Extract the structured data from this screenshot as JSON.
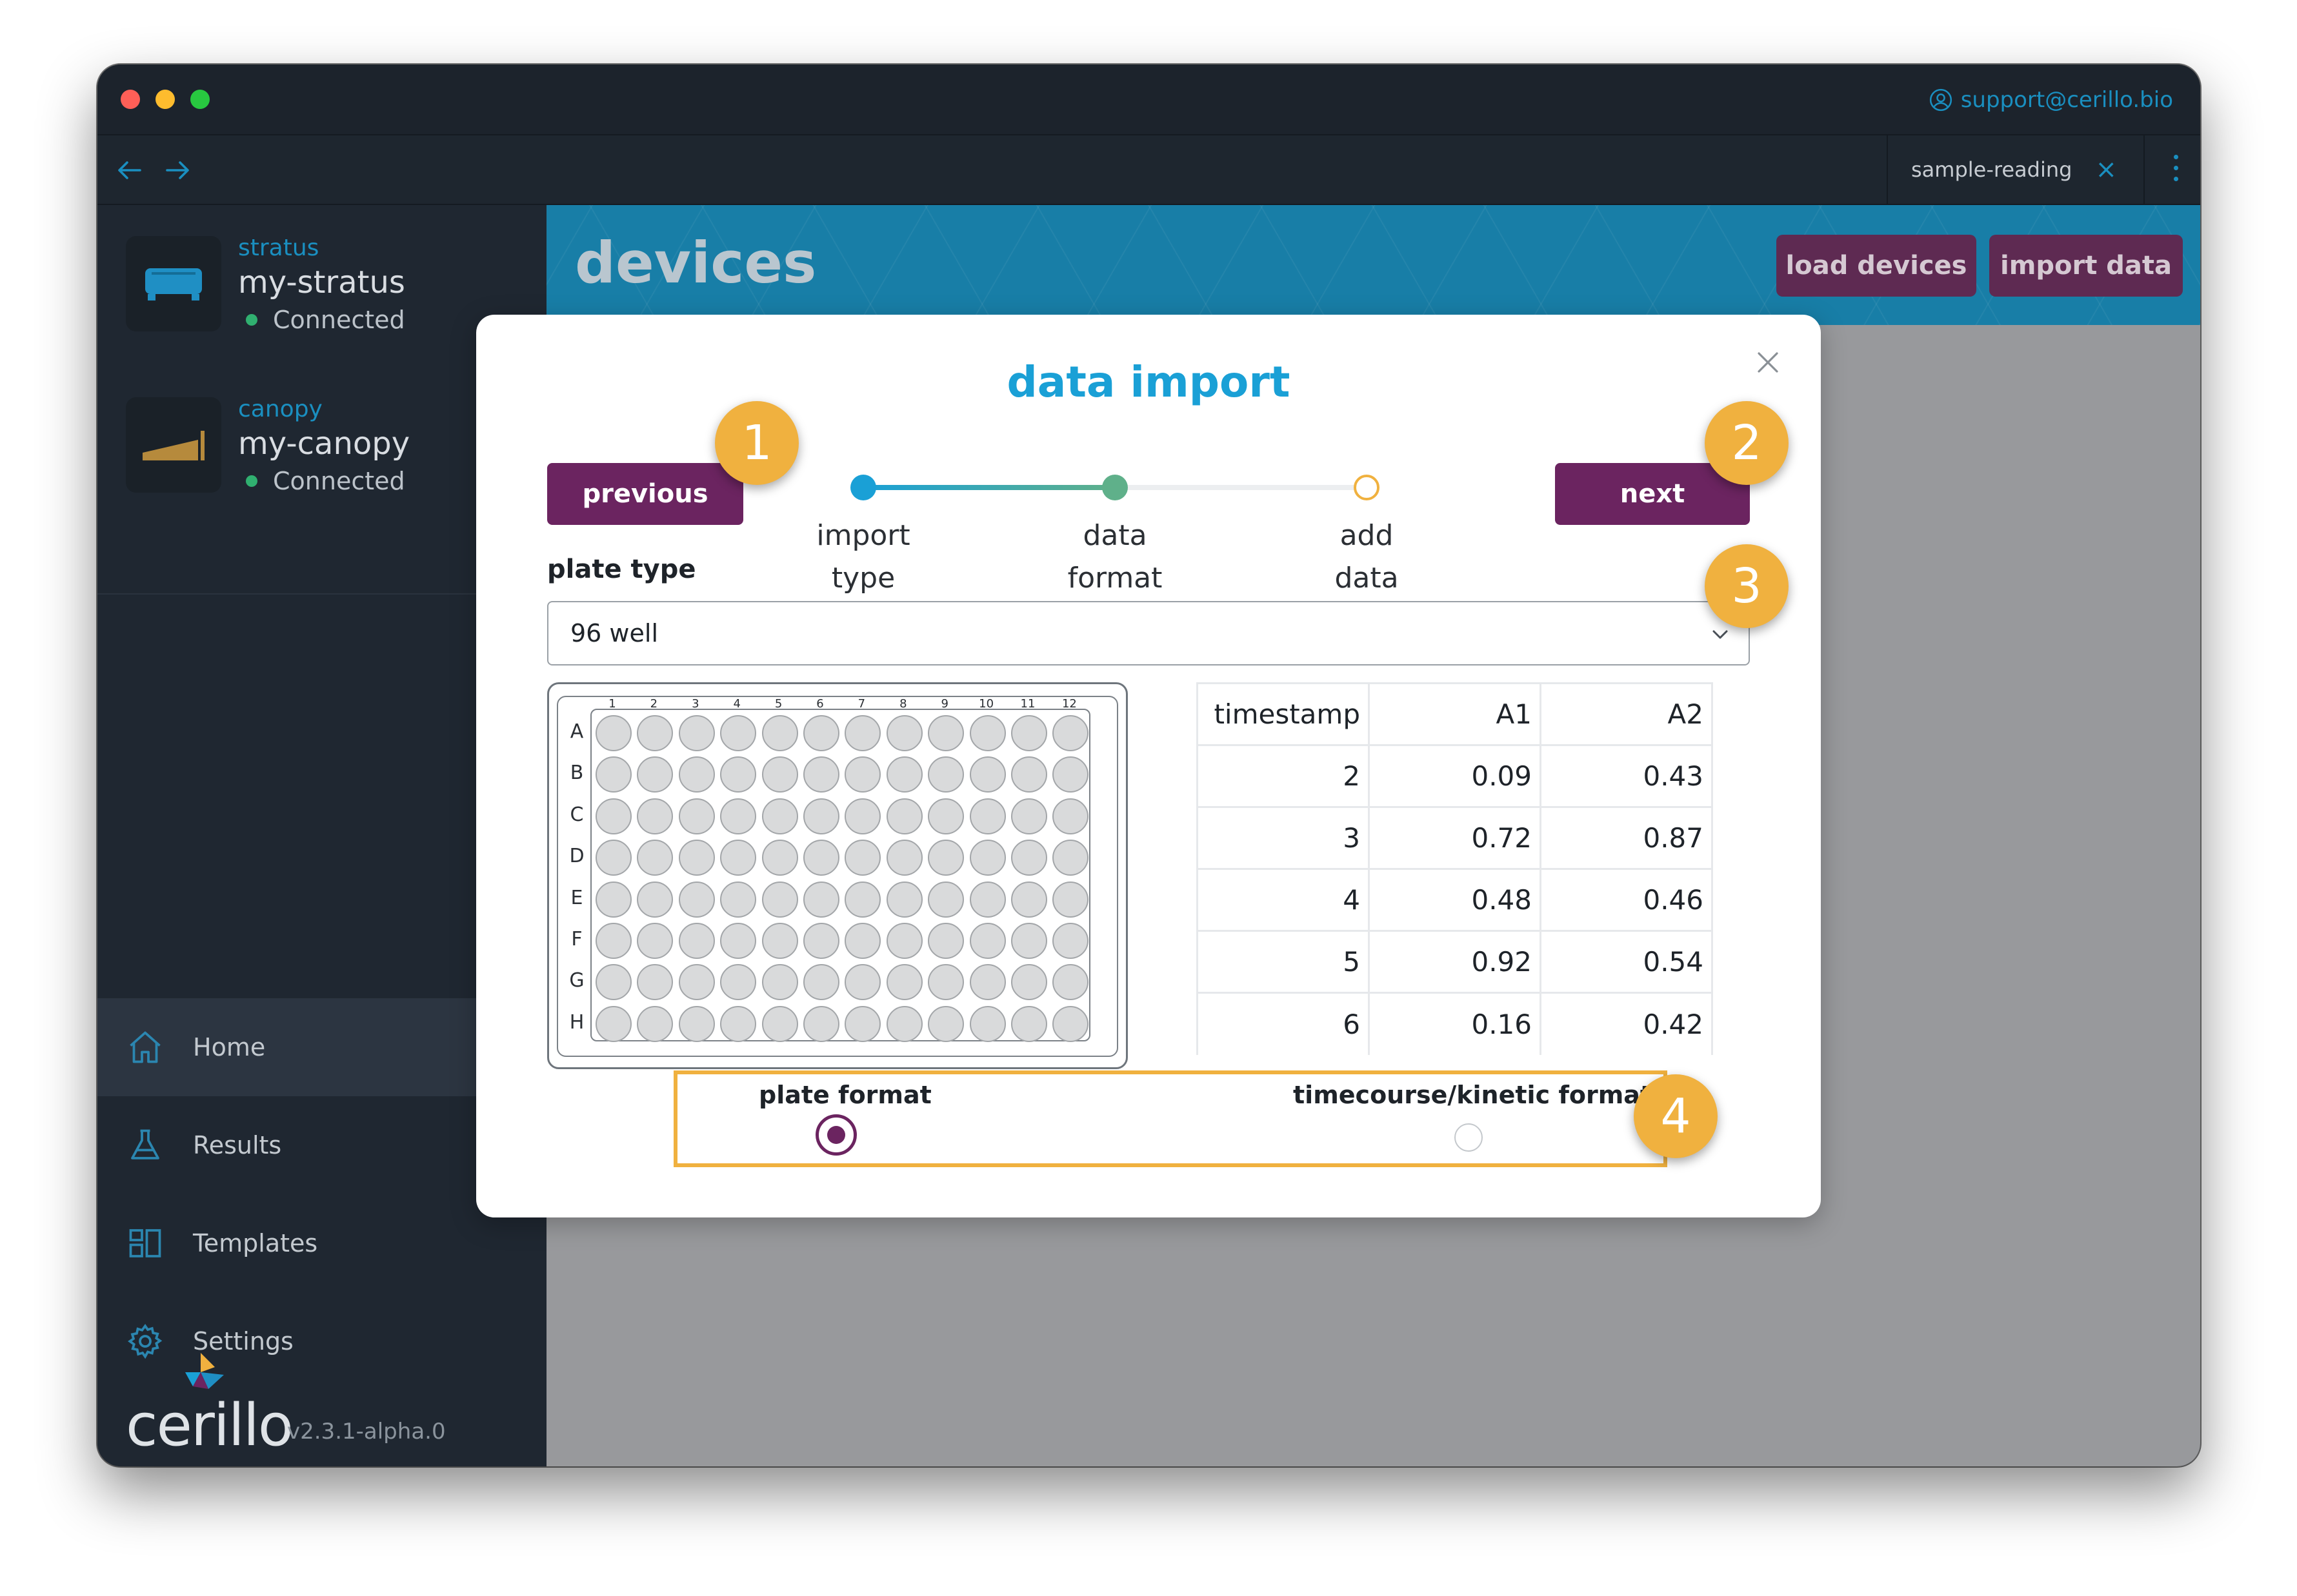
{
  "window": {
    "support_email": "support@cerillo.bio",
    "tab_label": "sample-reading"
  },
  "sidebar": {
    "devices": [
      {
        "type": "stratus",
        "name": "my-stratus",
        "status": "Connected"
      },
      {
        "type": "canopy",
        "name": "my-canopy",
        "status": "Connected"
      }
    ],
    "nav": [
      {
        "label": "Home",
        "icon": "home-icon",
        "active": true
      },
      {
        "label": "Results",
        "icon": "flask-icon"
      },
      {
        "label": "Templates",
        "icon": "templates-icon"
      },
      {
        "label": "Settings",
        "icon": "gear-icon"
      }
    ],
    "brand": "cerillo",
    "version": "v2.3.1-alpha.0"
  },
  "main": {
    "title": "devices",
    "load_devices": "load devices",
    "import_data": "import data"
  },
  "modal": {
    "title": "data import",
    "previous": "previous",
    "next": "next",
    "steps": [
      {
        "line1": "import",
        "line2": "type",
        "state": "done"
      },
      {
        "line1": "data",
        "line2": "format",
        "state": "current"
      },
      {
        "line1": "add",
        "line2": "data",
        "state": "pending"
      }
    ],
    "plate_type_label": "plate type",
    "plate_type_value": "96 well",
    "plate": {
      "columns": [
        "1",
        "2",
        "3",
        "4",
        "5",
        "6",
        "7",
        "8",
        "9",
        "10",
        "11",
        "12"
      ],
      "rows": [
        "A",
        "B",
        "C",
        "D",
        "E",
        "F",
        "G",
        "H"
      ]
    },
    "table": {
      "headers": [
        "timestamp",
        "A1",
        "A2"
      ],
      "rows": [
        [
          "2",
          "0.09",
          "0.43"
        ],
        [
          "3",
          "0.72",
          "0.87"
        ],
        [
          "4",
          "0.48",
          "0.46"
        ],
        [
          "5",
          "0.92",
          "0.54"
        ],
        [
          "6",
          "0.16",
          "0.42"
        ]
      ]
    },
    "formats": [
      {
        "label": "plate format",
        "selected": true
      },
      {
        "label": "timecourse/kinetic format",
        "selected": false
      }
    ]
  },
  "callouts": [
    "1",
    "2",
    "3",
    "4"
  ],
  "colors": {
    "accent_blue": "#1aa0d6",
    "primary_purple": "#6b2460",
    "callout_orange": "#f0b13f",
    "status_green": "#30b070"
  }
}
